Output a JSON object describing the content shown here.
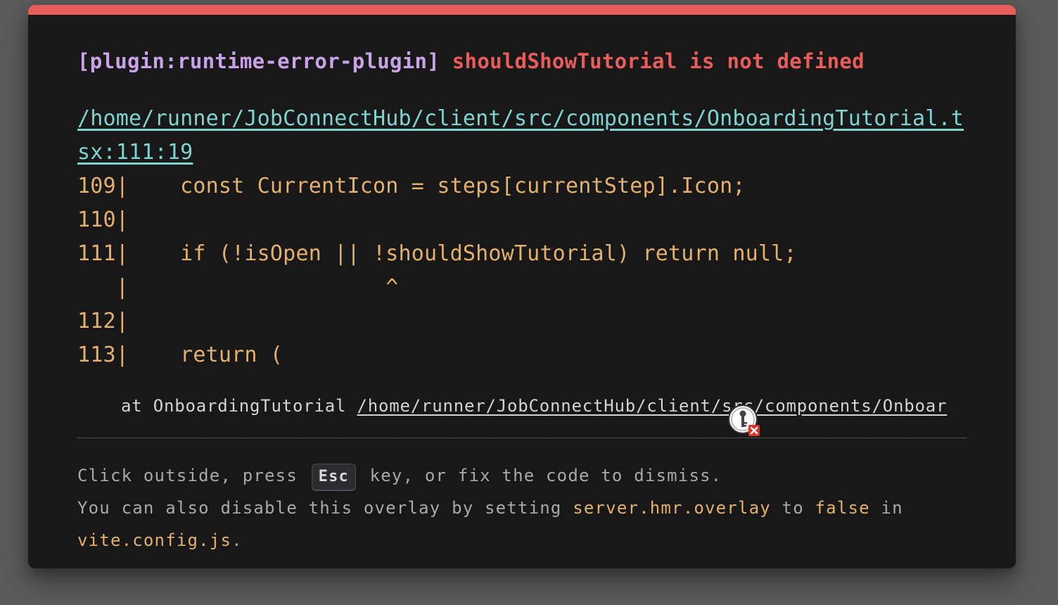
{
  "error": {
    "plugin_tag": "[plugin:runtime-error-plugin]",
    "message": "shouldShowTutorial is not defined",
    "file": "/home/runner/JobConnectHub/client/src/components/OnboardingTutorial.tsx:111:19",
    "frame_lines": [
      "109|    const CurrentIcon = steps[currentStep].Icon;",
      "110|",
      "111|    if (!isOpen || !shouldShowTutorial) return null;",
      "   |                    ^",
      "112|",
      "113|    return ("
    ],
    "stack_prefix": "at OnboardingTutorial ",
    "stack_link": "/home/runner/JobConnectHub/client/src/components/Onboar"
  },
  "tip": {
    "line1_before": "Click outside, press ",
    "key": "Esc",
    "line1_after": " key, or fix the code to dismiss.",
    "line2_before": "You can also disable this overlay by setting ",
    "setting": "server.hmr.overlay",
    "line2_mid": " to ",
    "value": "false",
    "line2_after": " in ",
    "config_file": "vite.config.js",
    "line2_end": "."
  },
  "icons": {
    "accent_bar_color": "#e85c5a",
    "key_badge": "key-error-icon"
  }
}
